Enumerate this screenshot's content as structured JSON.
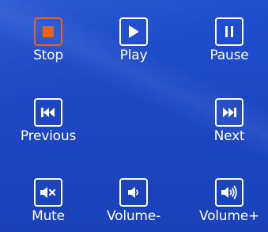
{
  "controls": {
    "stop": {
      "label": "Stop",
      "icon": "stop-icon",
      "active": true,
      "accent": "#e8631a"
    },
    "play": {
      "label": "Play",
      "icon": "play-icon"
    },
    "pause": {
      "label": "Pause",
      "icon": "pause-icon"
    },
    "previous": {
      "label": "Previous",
      "icon": "skip-previous-icon"
    },
    "next": {
      "label": "Next",
      "icon": "skip-next-icon"
    },
    "mute": {
      "label": "Mute",
      "icon": "mute-icon"
    },
    "voldown": {
      "label": "Volume-",
      "icon": "volume-down-icon"
    },
    "volup": {
      "label": "Volume+",
      "icon": "volume-up-icon"
    }
  },
  "colors": {
    "background": "#1c47c4",
    "foreground": "#ffffff",
    "active": "#e8631a"
  }
}
